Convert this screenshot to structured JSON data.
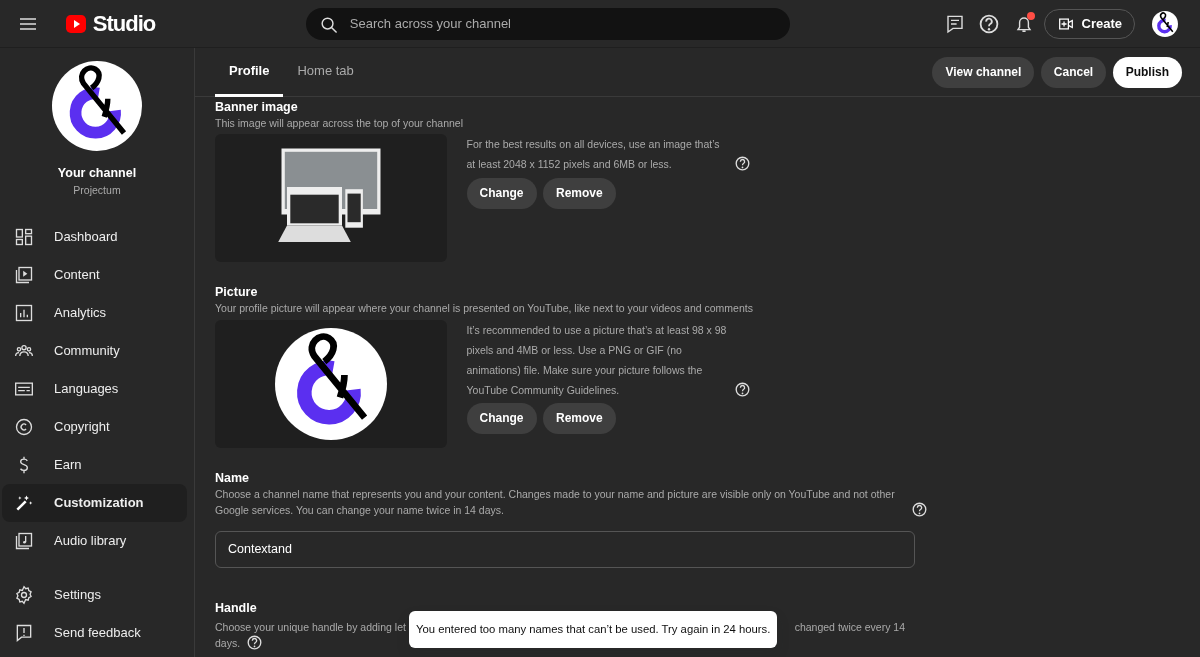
{
  "header": {
    "logo_text": "Studio",
    "search": {
      "placeholder": "Search across your channel"
    },
    "notifications": {
      "unread": true
    },
    "create_button": "Create"
  },
  "sidebar": {
    "channel_title": "Your channel",
    "channel_name": "Projectum",
    "items": [
      {
        "label": "Dashboard",
        "selected": false
      },
      {
        "label": "Content",
        "selected": false
      },
      {
        "label": "Analytics",
        "selected": false
      },
      {
        "label": "Community",
        "selected": false
      },
      {
        "label": "Languages",
        "selected": false
      },
      {
        "label": "Copyright",
        "selected": false
      },
      {
        "label": "Earn",
        "selected": false
      },
      {
        "label": "Customization",
        "selected": true
      },
      {
        "label": "Audio library",
        "selected": false
      }
    ],
    "footer_items": [
      {
        "label": "Settings",
        "selected": false
      },
      {
        "label": "Send feedback",
        "selected": false
      }
    ]
  },
  "tabs": [
    {
      "label": "Profile",
      "selected": true
    },
    {
      "label": "Home tab",
      "selected": false
    }
  ],
  "actions": [
    {
      "label": "View channel",
      "kind": "secondary"
    },
    {
      "label": "Cancel",
      "kind": "secondary"
    },
    {
      "label": "Publish",
      "kind": "primary"
    }
  ],
  "sections": [
    {
      "kind": "image",
      "heading": "Banner image",
      "description": "This image will appear across the top of your channel",
      "info": "For the best results on all devices, use an image that’s at least 2048 x 1152 pixels and 6MB or less.",
      "buttons": [
        "Change",
        "Remove"
      ]
    },
    {
      "kind": "image",
      "heading": "Picture",
      "description": "Your profile picture will appear where your channel is presented on YouTube, like next to your videos and comments",
      "info": "It’s recommended to use a picture that’s at least 98 x 98 pixels and 4MB or less. Use a PNG or GIF (no animations) file. Make sure your picture follows the YouTube Community Guidelines.",
      "buttons": [
        "Change",
        "Remove"
      ]
    },
    {
      "kind": "field",
      "heading": "Name",
      "description": "Choose a channel name that represents you and your content. Changes made to your name and picture are visible only on YouTube and not other Google services. You can change your name twice in 14 days.",
      "value": "Contextand"
    },
    {
      "kind": "covered_field",
      "heading": "Handle",
      "description_start": "Choose your unique handle by adding let",
      "description_end": "changed twice every 14",
      "description_tail": "days."
    }
  ],
  "toast": {
    "message": "You entered too many names that can’t be used. Try again in 24 hours."
  }
}
